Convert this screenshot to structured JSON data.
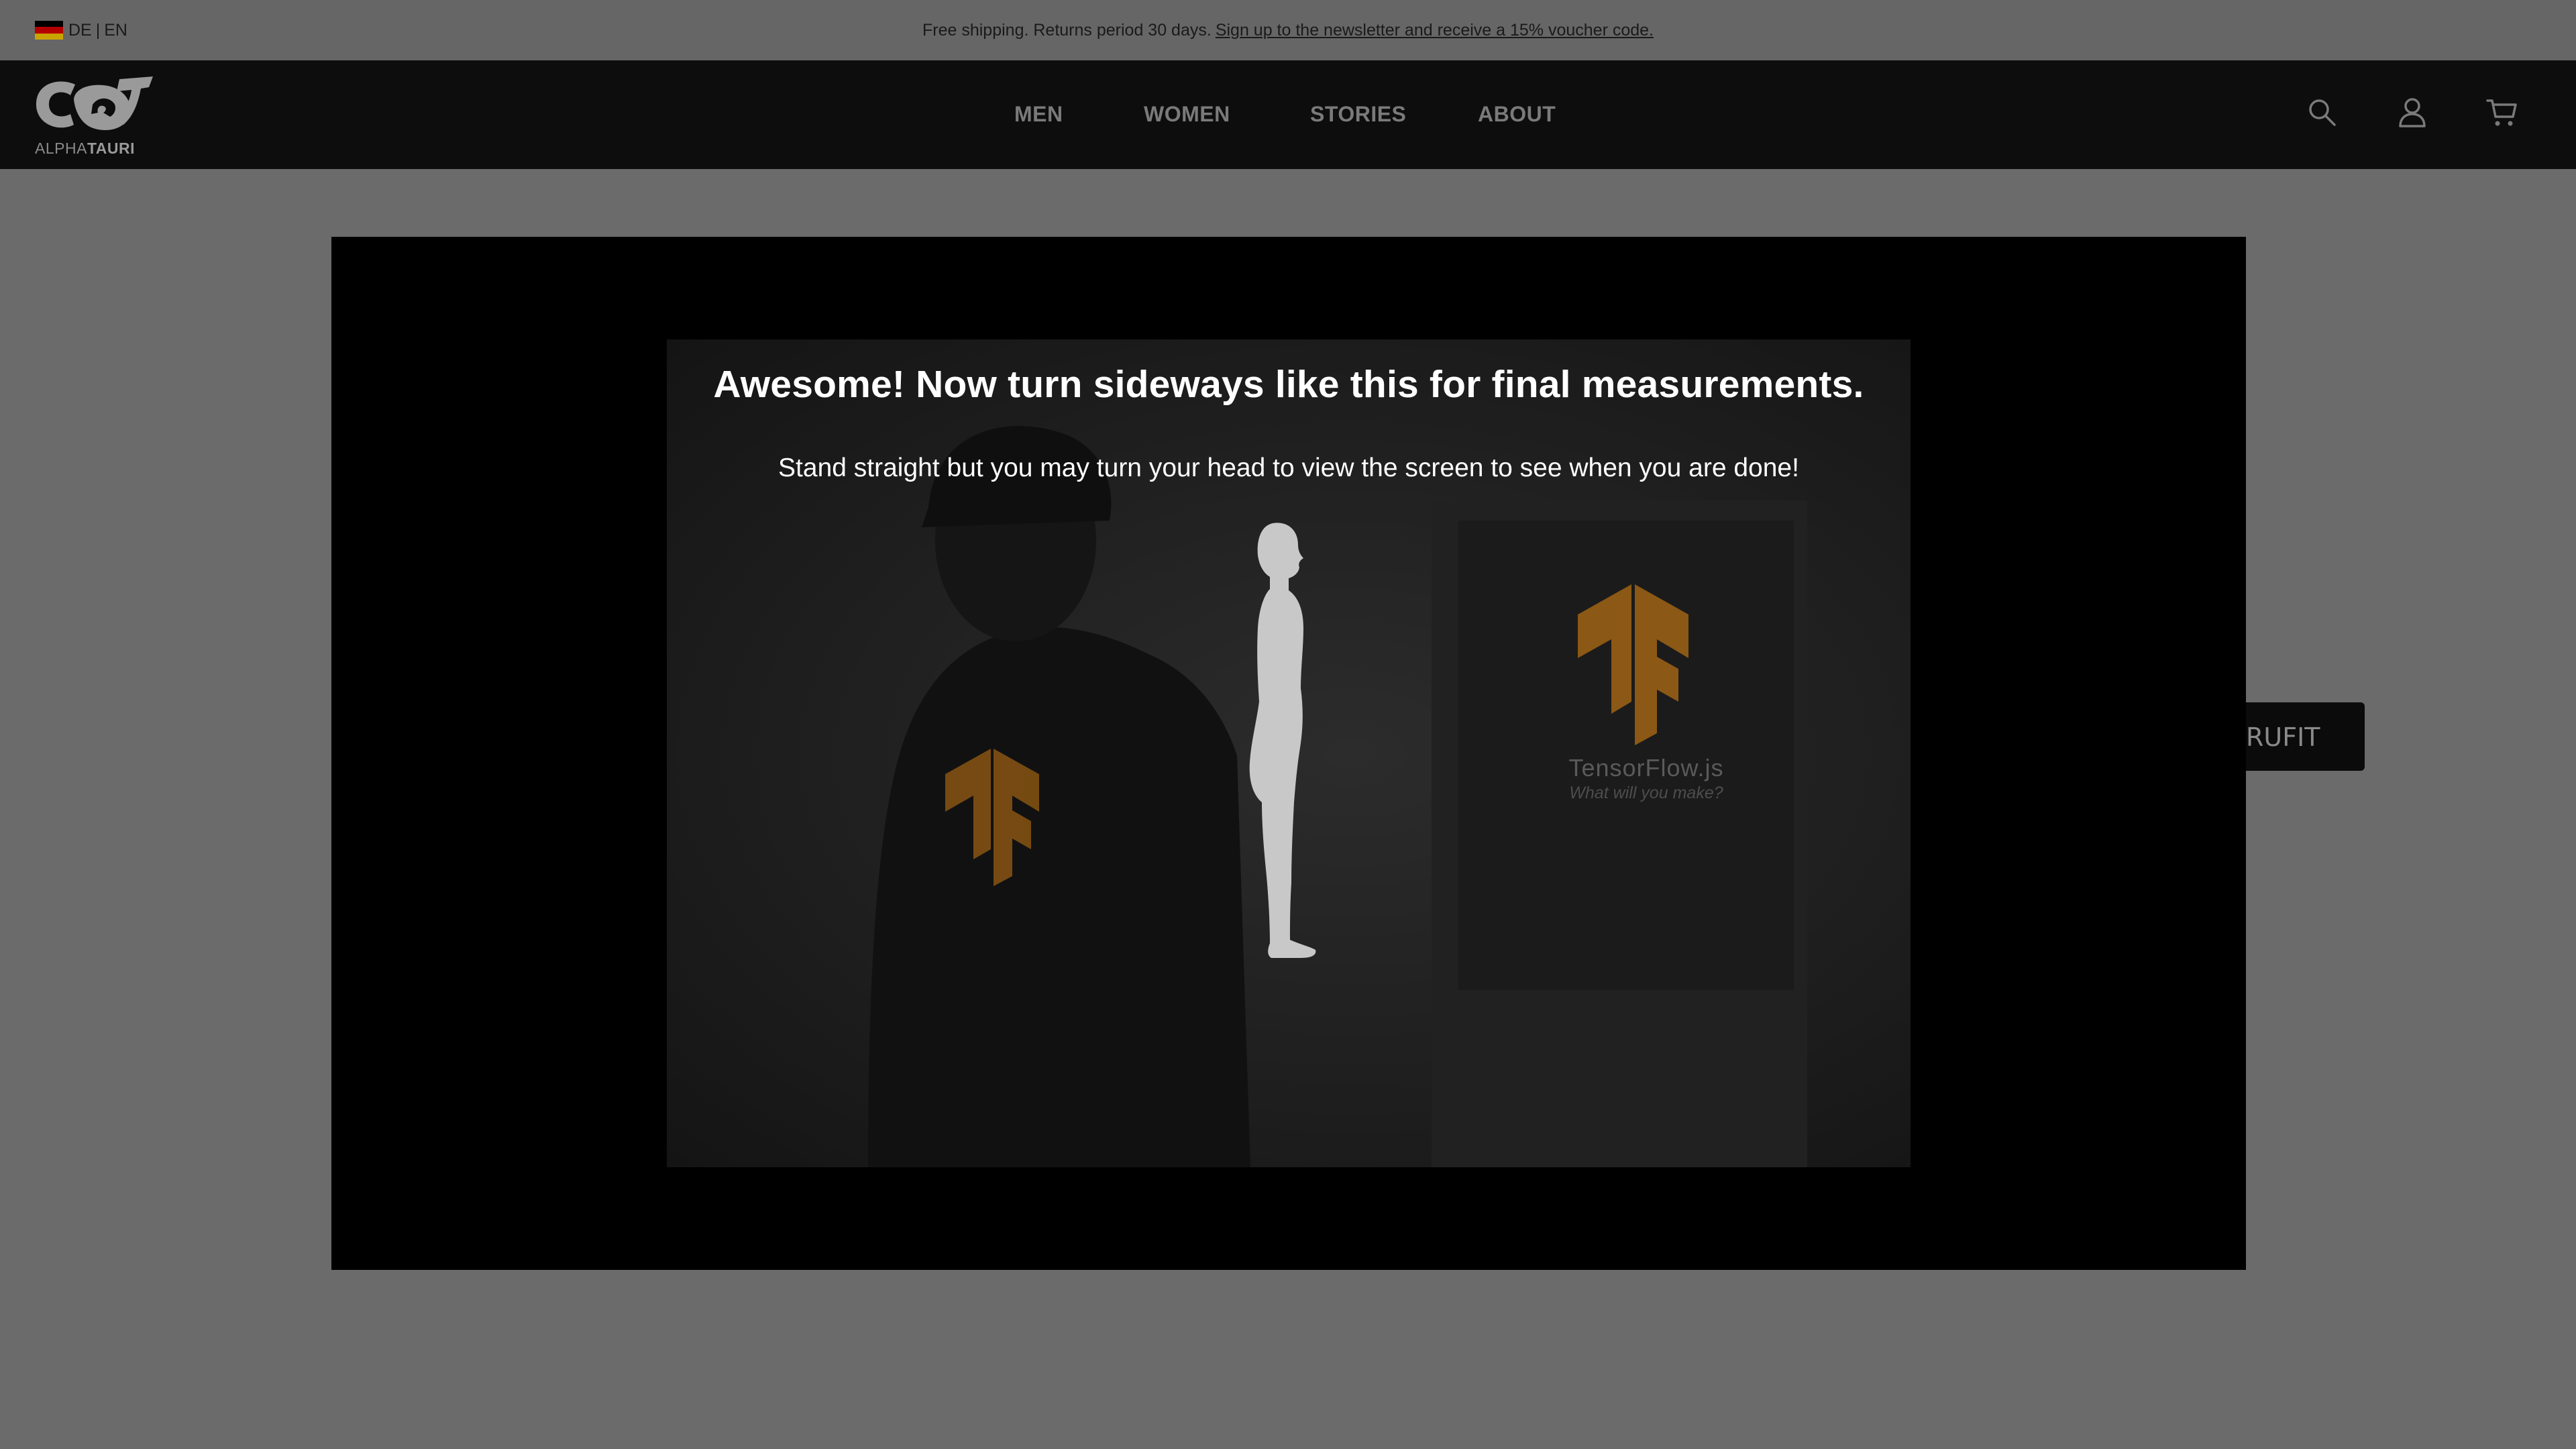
{
  "topbar": {
    "lang_de": "DE",
    "lang_sep": "|",
    "lang_en": "EN",
    "promo_text": "Free shipping. Returns period 30 days.",
    "promo_link": "Sign up to the newsletter and receive a 15% voucher code."
  },
  "header": {
    "logo_text_light": "ALPHA",
    "logo_text_bold": "TAURI",
    "nav": [
      "MEN",
      "WOMEN",
      "STORIES",
      "ABOUT"
    ],
    "icons": [
      "search-icon",
      "account-icon",
      "cart-icon"
    ]
  },
  "page": {
    "button_partial_label": "RUFIT"
  },
  "modal": {
    "headline": "Awesome! Now turn sideways like this for final measurements.",
    "subline": "Stand straight but you may turn your head to view the screen to see when you are done!",
    "shirt_brand": "TensorFlow.js",
    "shirt_tagline": "What will you make?"
  },
  "colors": {
    "overlay_gray": "#6b6b6b",
    "header_bg": "#0d0d0d",
    "modal_bg": "#000000",
    "tf_orange": "#c97a13",
    "silhouette": "#c8c8c8"
  }
}
